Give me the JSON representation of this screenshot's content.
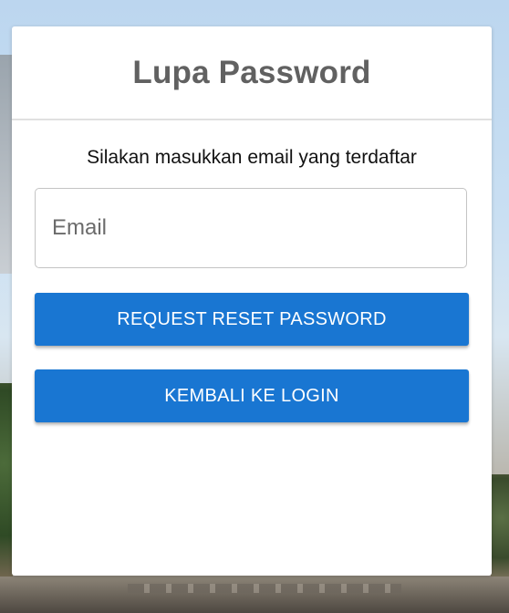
{
  "card": {
    "title": "Lupa Password",
    "instruction": "Silakan masukkan email yang terdaftar"
  },
  "form": {
    "email_value": "",
    "email_placeholder": "Email",
    "request_reset_label": "REQUEST RESET PASSWORD",
    "back_to_login_label": "KEMBALI KE LOGIN"
  },
  "colors": {
    "primary_button": "#1976d2",
    "title_text": "#616161"
  }
}
